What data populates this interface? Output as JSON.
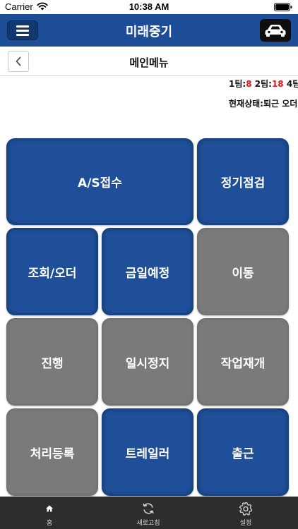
{
  "status_bar": {
    "carrier": "Carrier",
    "time": "10:38 AM"
  },
  "navbar": {
    "title": "미래중기"
  },
  "subheader": {
    "title": "메인메뉴"
  },
  "teams": [
    {
      "label": "1팀:",
      "count": "8"
    },
    {
      "label": "2팀:",
      "count": "18"
    },
    {
      "label": "4팀:",
      "count": ""
    }
  ],
  "state": {
    "label": "현재상태:",
    "value": "퇴근 오더"
  },
  "tiles": {
    "as_receipt": "A/S접수",
    "regular_check": "정기점검",
    "inquiry_order": "조회/오더",
    "today_schedule": "금일예정",
    "move": "이동",
    "progress": "진행",
    "pause": "일시정지",
    "resume": "작업재개",
    "register": "처리등록",
    "trailer": "트레일러",
    "depart": "출근"
  },
  "tabbar": {
    "home": "홈",
    "refresh": "새로고침",
    "settings": "설정"
  },
  "colors": {
    "primary": "#1c4d96",
    "tile_blue": "#1e4f98",
    "tile_gray": "#7a7a7a",
    "highlight_red": "#e0131a",
    "tabbar": "#2d2d2d"
  }
}
